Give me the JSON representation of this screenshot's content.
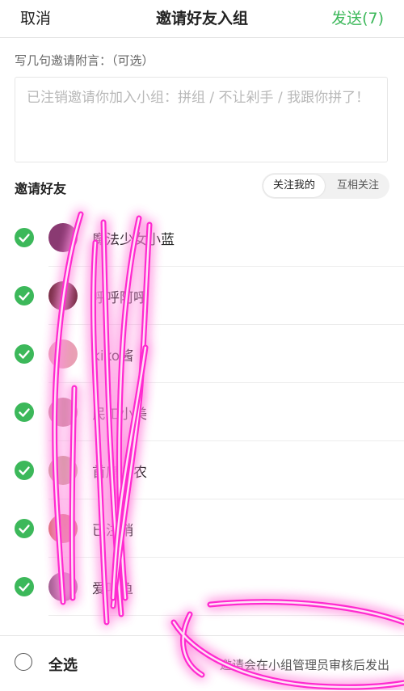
{
  "header": {
    "cancel_label": "取消",
    "title": "邀请好友入组",
    "send_label": "发送(7)",
    "send_color": "#3cb85a"
  },
  "message": {
    "label": "写几句邀请附言：（可选）",
    "placeholder": "已注销邀请你加入小组：拼组 / 不让剁手 / 我跟你拼了！"
  },
  "friends": {
    "label": "邀请好友",
    "tabs": [
      "关注我的",
      "互相关注"
    ],
    "active_tab": "关注我的",
    "items": [
      {
        "name": "魔法少女小蓝",
        "checked": true,
        "avatar_color": "#8a3a72"
      },
      {
        "name": "呼呼阿呼",
        "checked": true,
        "avatar_color": "#7a3048"
      },
      {
        "name": "kiko酱",
        "checked": true,
        "avatar_color": "#e9a0b4"
      },
      {
        "name": "民工小美",
        "checked": true,
        "avatar_color": "#c98a9a"
      },
      {
        "name": "首席瓜农",
        "checked": true,
        "avatar_color": "#c4a08a"
      },
      {
        "name": "已注销",
        "checked": true,
        "avatar_color": "#d86a6a"
      },
      {
        "name": "爱吃鱼",
        "checked": true,
        "avatar_color": "#a06090"
      }
    ]
  },
  "footer": {
    "select_all_label": "全选",
    "notice": "邀请会在小组管理员审核后发出"
  },
  "colors": {
    "check_green": "#3cb85a",
    "scribble_pink": "#ff2bd0"
  }
}
